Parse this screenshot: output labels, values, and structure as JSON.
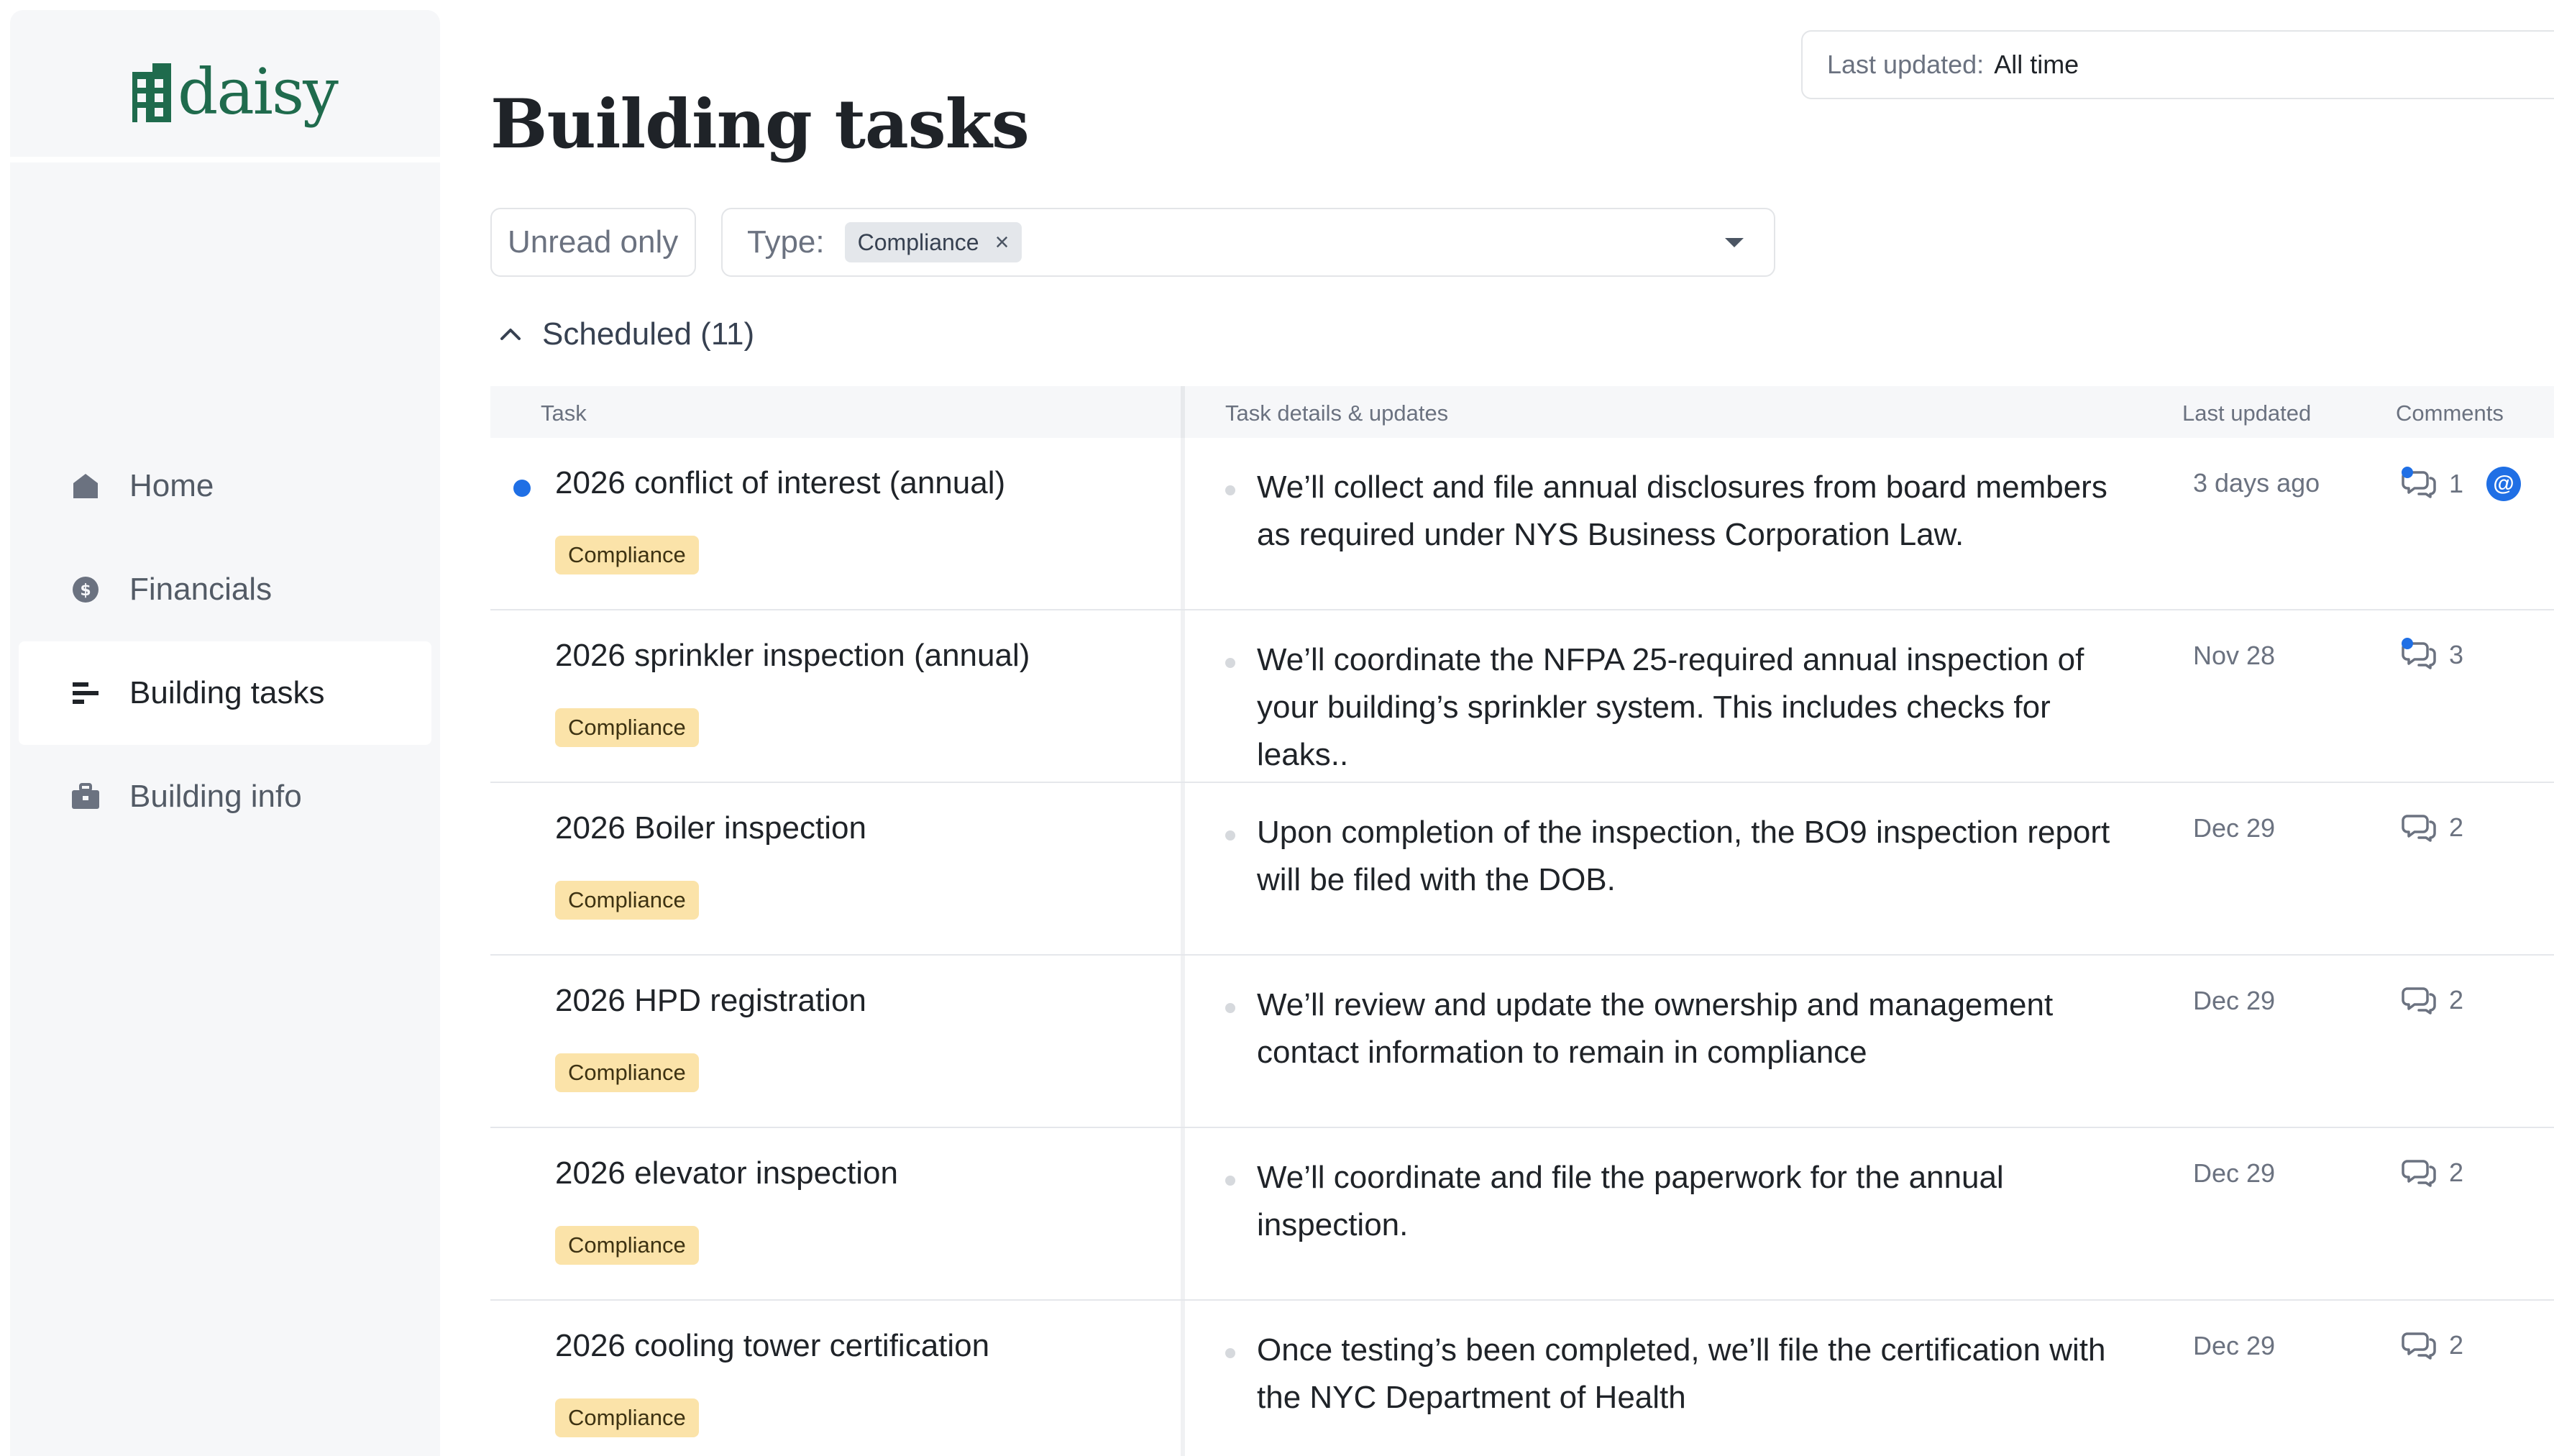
{
  "brand": {
    "name": "daisy",
    "color": "#1f6b4d",
    "logo_icon": "building-grid-icon"
  },
  "sidebar": {
    "items": [
      {
        "label": "Home",
        "icon": "home-icon"
      },
      {
        "label": "Financials",
        "icon": "dollar-circle-icon"
      },
      {
        "label": "Building tasks",
        "icon": "task-list-icon",
        "active": true
      },
      {
        "label": "Building info",
        "icon": "briefcase-icon"
      }
    ]
  },
  "page": {
    "title": "Building tasks"
  },
  "filters": {
    "unread_label": "Unread only",
    "type_label": "Type:",
    "type_chip": "Compliance",
    "type_chip_remove": "×",
    "updated_label": "Last updated:",
    "updated_value": "All time"
  },
  "group": {
    "title": "Scheduled (11)",
    "expanded": true
  },
  "table": {
    "columns": {
      "task": "Task",
      "details": "Task details & updates",
      "updated": "Last updated",
      "comments": "Comments"
    },
    "rows": [
      {
        "name": "2026 conflict of interest (annual)",
        "tag": "Compliance",
        "unread": true,
        "details": "We’ll collect and file annual disclosures from board members as required under NYS Business Corporation Law.",
        "updated": "3 days ago",
        "comments": "1",
        "new_comment": true,
        "mention": "@"
      },
      {
        "name": "2026 sprinkler inspection (annual)",
        "tag": "Compliance",
        "unread": false,
        "details": "We’ll coordinate the NFPA 25-required annual inspection of your building’s sprinkler system. This includes checks for leaks..",
        "updated": "Nov 28",
        "comments": "3",
        "new_comment": true
      },
      {
        "name": "2026 Boiler inspection",
        "tag": "Compliance",
        "unread": false,
        "details": "Upon completion of the inspection, the BO9 inspection report will be filed with the DOB.",
        "updated": "Dec 29",
        "comments": "2",
        "new_comment": false
      },
      {
        "name": "2026 HPD registration",
        "tag": "Compliance",
        "unread": false,
        "details": "We’ll review and update the ownership and management contact information to remain in compliance",
        "updated": "Dec 29",
        "comments": "2",
        "new_comment": false
      },
      {
        "name": "2026 elevator inspection",
        "tag": "Compliance",
        "unread": false,
        "details": "We’ll coordinate and file the paperwork for the annual inspection.",
        "updated": "Dec 29",
        "comments": "2",
        "new_comment": false
      },
      {
        "name": "2026 cooling tower certification",
        "tag": "Compliance",
        "unread": false,
        "details": "Once testing’s been completed, we’ll file the certification with the NYC Department of Health",
        "updated": "Dec 29",
        "comments": "2",
        "new_comment": false
      }
    ]
  },
  "colors": {
    "accent": "#1f6fe5",
    "tag_bg": "#fbe3a9",
    "sidebar_bg": "#f6f7f9"
  }
}
